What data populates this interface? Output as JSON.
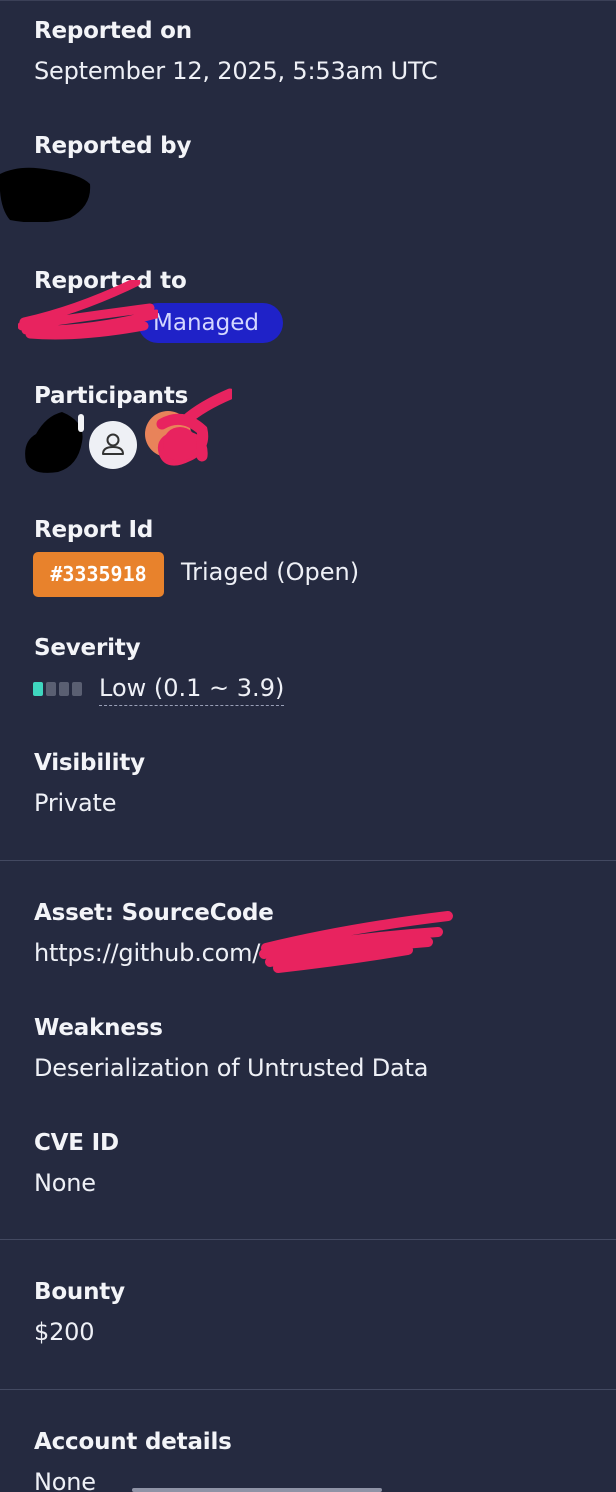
{
  "reported_on": {
    "label": "Reported on",
    "value": "September 12, 2025, 5:53am UTC"
  },
  "reported_by": {
    "label": "Reported by"
  },
  "reported_to": {
    "label": "Reported to",
    "badge": "Managed"
  },
  "participants": {
    "label": "Participants",
    "icons": [
      "avatar",
      "user-icon",
      "avatar"
    ]
  },
  "report_id": {
    "label": "Report Id",
    "id": "#3335918",
    "status": "Triaged (Open)"
  },
  "severity": {
    "label": "Severity",
    "value": "Low (0.1 ~ 3.9)",
    "level": 1,
    "max_level": 4,
    "color": "#3fd6bf"
  },
  "visibility": {
    "label": "Visibility",
    "value": "Private"
  },
  "asset": {
    "label": "Asset: SourceCode",
    "value": "https://github.com/"
  },
  "weakness": {
    "label": "Weakness",
    "value": "Deserialization of Untrusted Data"
  },
  "cve": {
    "label": "CVE ID",
    "value": "None"
  },
  "bounty": {
    "label": "Bounty",
    "value": "$200"
  },
  "account_details": {
    "label": "Account details",
    "value": "None"
  },
  "colors": {
    "background": "#252a40",
    "managed_badge": "#1f22c8",
    "report_badge": "#e8822c",
    "redaction": "#e8235f"
  }
}
